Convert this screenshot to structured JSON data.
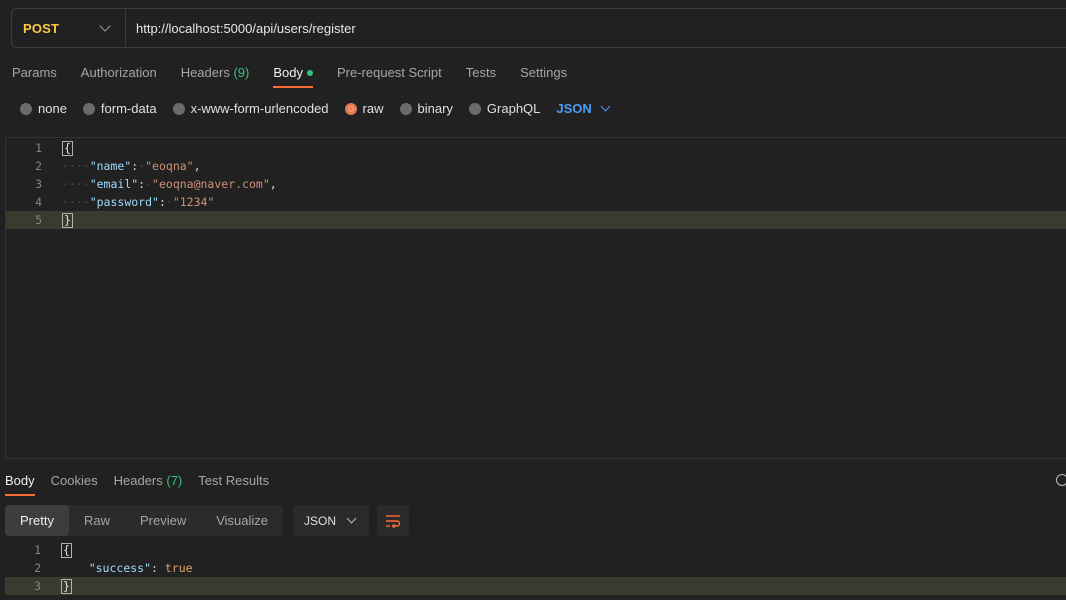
{
  "request": {
    "method": "POST",
    "url": "http://localhost:5000/api/users/register"
  },
  "request_tabs": [
    {
      "label": "Params"
    },
    {
      "label": "Authorization"
    },
    {
      "label": "Headers",
      "count": "(9)"
    },
    {
      "label": "Body",
      "active": true
    },
    {
      "label": "Pre-request Script"
    },
    {
      "label": "Tests"
    },
    {
      "label": "Settings"
    }
  ],
  "body_types": [
    "none",
    "form-data",
    "x-www-form-urlencoded",
    "raw",
    "binary",
    "GraphQL"
  ],
  "body_type_selected": "raw",
  "body_language": "JSON",
  "request_body": {
    "line_numbers": [
      "1",
      "2",
      "3",
      "4",
      "5"
    ],
    "open_brace": "{",
    "close_brace": "}",
    "fields": [
      {
        "key": "\"name\"",
        "value": "\"eoqna\"",
        "comma": ","
      },
      {
        "key": "\"email\"",
        "value": "\"eoqna@naver.com\"",
        "comma": ","
      },
      {
        "key": "\"password\"",
        "value": "\"1234\"",
        "comma": ""
      }
    ]
  },
  "response_tabs": [
    {
      "label": "Body",
      "active": true
    },
    {
      "label": "Cookies"
    },
    {
      "label": "Headers",
      "count": "(7)"
    },
    {
      "label": "Test Results"
    }
  ],
  "response_views": [
    "Pretty",
    "Raw",
    "Preview",
    "Visualize"
  ],
  "response_view_selected": "Pretty",
  "response_format": "JSON",
  "response_body": {
    "line_numbers": [
      "1",
      "2",
      "3"
    ],
    "open_brace": "{",
    "close_brace": "}",
    "key": "\"success\"",
    "value": "true"
  },
  "colors": {
    "accent": "#ff6c37",
    "method": "#ffc845",
    "count": "#34c17a",
    "link": "#4a9ff5"
  }
}
